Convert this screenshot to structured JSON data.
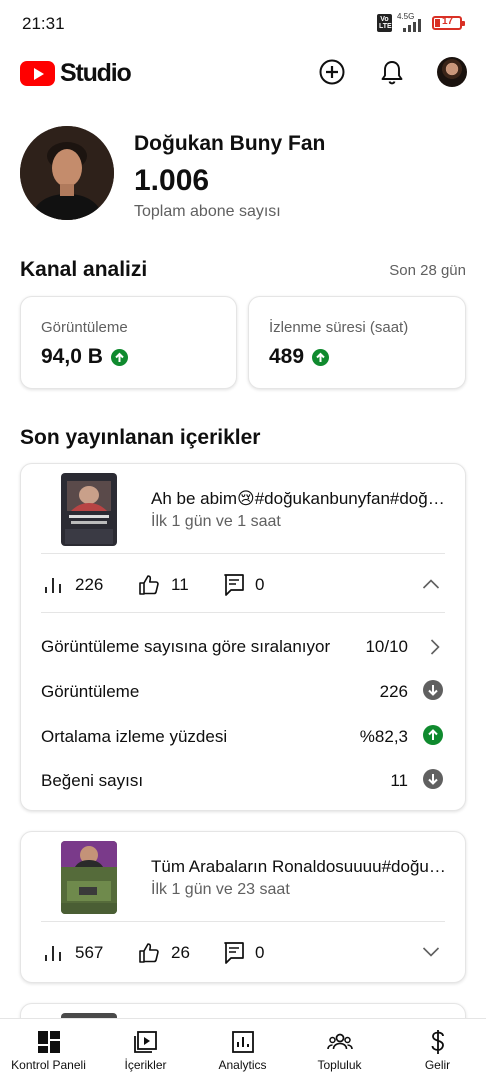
{
  "status_bar": {
    "time": "21:31",
    "volte": "Vo LTE",
    "network": "4.5G",
    "battery": "17"
  },
  "header": {
    "logo_text": "Studio",
    "icons": [
      "add-icon",
      "bell-icon",
      "avatar"
    ]
  },
  "profile": {
    "name": "Doğukan Buny Fan",
    "subscribers": "1.006",
    "subscribers_label": "Toplam abone sayısı"
  },
  "channel_analytics": {
    "title": "Kanal analizi",
    "period": "Son 28 gün",
    "metrics": [
      {
        "label": "Görüntüleme",
        "value": "94,0 B",
        "trend": "up"
      },
      {
        "label": "İzlenme süresi (saat)",
        "value": "489",
        "trend": "up"
      }
    ]
  },
  "recent": {
    "title": "Son yayınlanan içerikler",
    "videos": [
      {
        "title": "Ah be abim😢#doğukanbunyfan#doğukanbuny",
        "age": "İlk 1 gün ve 1 saat",
        "views": "226",
        "likes": "11",
        "comments": "0",
        "expanded": true,
        "details": [
          {
            "label": "Görüntüleme sayısına göre sıralanıyor",
            "value": "10/10",
            "indicator": "chevron-right"
          },
          {
            "label": "Görüntüleme",
            "value": "226",
            "indicator": "down"
          },
          {
            "label": "Ortalama izleme yüzdesi",
            "value": "%82,3",
            "indicator": "up"
          },
          {
            "label": "Beğeni sayısı",
            "value": "11",
            "indicator": "down"
          }
        ]
      },
      {
        "title": "Tüm Arabaların Ronaldosuuuu#doğukanbuny",
        "age": "İlk 1 gün ve 23 saat",
        "views": "567",
        "likes": "26",
        "comments": "0",
        "expanded": false
      }
    ]
  },
  "bottom_nav": [
    {
      "label": "Kontrol Paneli",
      "icon": "dashboard-icon",
      "active": true
    },
    {
      "label": "İçerikler",
      "icon": "content-icon",
      "active": false
    },
    {
      "label": "Analytics",
      "icon": "analytics-icon",
      "active": false
    },
    {
      "label": "Topluluk",
      "icon": "community-icon",
      "active": false
    },
    {
      "label": "Gelir",
      "icon": "dollar-icon",
      "active": false
    }
  ],
  "colors": {
    "brand": "#ff0000",
    "trend_up": "#0f8a2e",
    "trend_down": "#606060",
    "text_secondary": "#606060"
  }
}
